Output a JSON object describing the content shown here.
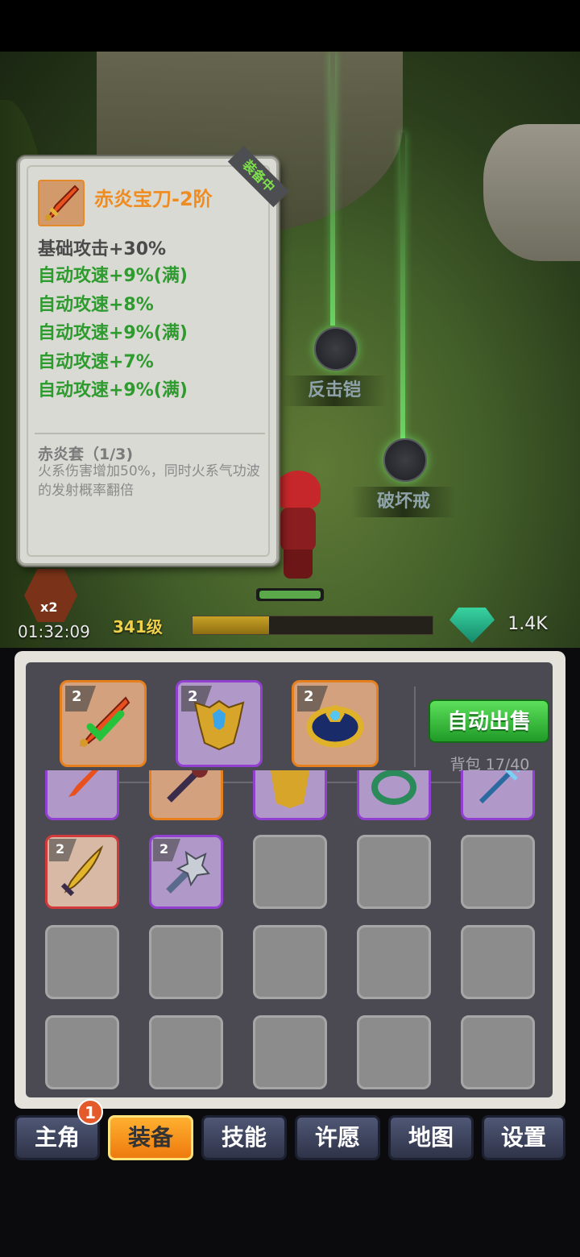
{
  "tooltip": {
    "item_name": "赤炎宝刀-2阶",
    "equipped_tag": "装备中",
    "base_stat": "基础攻击+30%",
    "stats": [
      "自动攻速+9%(满)",
      "自动攻速+8%",
      "自动攻速+9%(满)",
      "自动攻速+7%",
      "自动攻速+9%(满)"
    ],
    "set_name": "赤炎套（1/3)",
    "set_desc": "火系伤害增加50%，同时火系气功波的发射概率翻倍"
  },
  "scene": {
    "drop1_label": "反击铠",
    "drop2_label": "破坏戒"
  },
  "hud": {
    "speed_multiplier": "x2",
    "timer": "01:32:09",
    "level": "341级",
    "xp_progress": 0.32,
    "gems": "1.4K"
  },
  "equipped": [
    {
      "name": "sword",
      "tier": "2",
      "rarity": "orange"
    },
    {
      "name": "armor",
      "tier": "2",
      "rarity": "purple"
    },
    {
      "name": "ring",
      "tier": "2",
      "rarity": "orange"
    }
  ],
  "inventory_panel": {
    "auto_sell_label": "自动出售",
    "bag_label": "背包 17/40",
    "row_partial": [
      "sword-purple",
      "mace-orange",
      "armor-purple",
      "ring-purple",
      "trident-purple"
    ],
    "row2": [
      {
        "rarity": "red",
        "tier": "2",
        "icon": "golden-blade"
      },
      {
        "rarity": "purple",
        "tier": "2",
        "icon": "spiked-mace"
      }
    ]
  },
  "nav": {
    "items": [
      "主角",
      "装备",
      "技能",
      "许愿",
      "地图",
      "设置"
    ],
    "active": "装备",
    "badge": "1"
  },
  "colors": {
    "stat_green": "#2e9b2e",
    "title_orange": "#ef8b1f",
    "rarity_orange": "#e6801e",
    "rarity_purple": "#9140d0",
    "rarity_red": "#d03a3a"
  }
}
